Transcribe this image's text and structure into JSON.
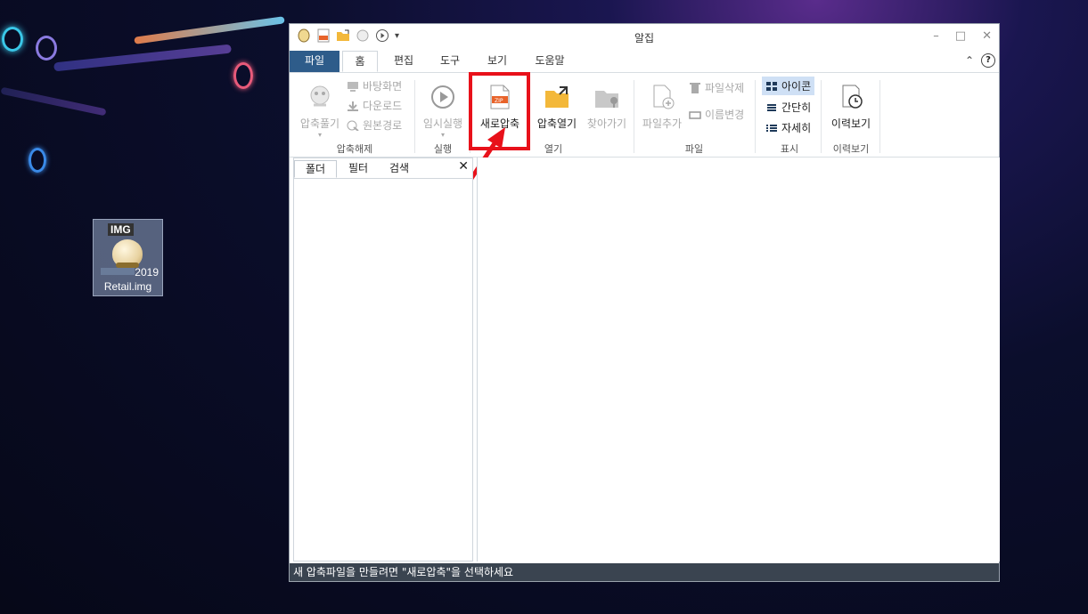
{
  "desktop": {
    "icon": {
      "badge": "IMG",
      "name_line1": "2019",
      "name_line2": "Retail.img"
    }
  },
  "window": {
    "title": "알집",
    "tabs": [
      "파일",
      "홈",
      "편집",
      "도구",
      "보기",
      "도움말"
    ],
    "active_tab": "홈",
    "controls": {
      "minimize": "–",
      "maximize": "□",
      "close": "✕"
    },
    "ribbon_right": {
      "collapse": "⌃",
      "help": "?"
    },
    "ribbon": {
      "extract_group": {
        "big_label": "압축풀기",
        "small_items": [
          "바탕화면",
          "다운로드",
          "원본경로"
        ],
        "group_label": "압축해제"
      },
      "run_group": {
        "big_label": "임시실행",
        "group_label": "실행"
      },
      "open_group": {
        "new_label": "새로압축",
        "open_label": "압축열기",
        "find_label": "찾아가기",
        "group_label": "열기"
      },
      "file_group": {
        "big_label": "파일추가",
        "small_items": [
          "파일삭제",
          "이름변경"
        ],
        "group_label": "파일"
      },
      "display_group": {
        "items": [
          "아이콘",
          "간단히",
          "자세히"
        ],
        "selected": "아이콘",
        "group_label": "표시"
      },
      "history_group": {
        "big_label": "이력보기",
        "group_label": "이력보기"
      }
    },
    "left_panel": {
      "tabs": [
        "폴더",
        "필터",
        "검색"
      ],
      "close": "✕"
    },
    "status": "새 압축파일을 만들려면 \"새로압축\"을 선택하세요"
  },
  "colors": {
    "highlight": "#e8111a",
    "file_tab": "#2e5c8a",
    "statusbar": "#3a4450",
    "selected": "#cfe0f5"
  }
}
